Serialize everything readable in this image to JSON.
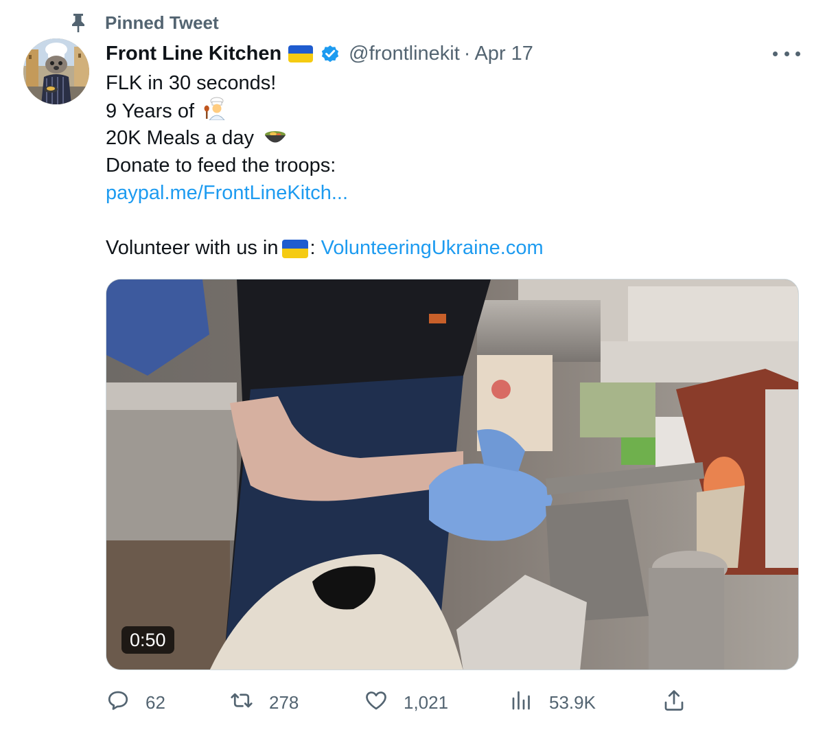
{
  "pinned": {
    "label": "Pinned Tweet",
    "icon": "pin-icon"
  },
  "author": {
    "display_name": "Front Line Kitchen",
    "handle": "@frontlinekit",
    "separator": "·",
    "date": "Apr 17",
    "verified": true
  },
  "body": {
    "line1": "FLK in 30 seconds!",
    "line2": "9 Years of",
    "line3": "20K Meals a day",
    "line4": "Donate to feed the troops:",
    "link1": "paypal.me/FrontLineKitch...",
    "line6_prefix": "Volunteer with us in",
    "line6_colon": ":",
    "link2": "VolunteeringUkraine.com"
  },
  "media": {
    "duration": "0:50"
  },
  "actions": {
    "replies": "62",
    "retweets": "278",
    "likes": "1,021",
    "views": "53.9K"
  },
  "colors": {
    "link": "#1d9bf0",
    "secondary_text": "#536471",
    "verified": "#1d9bf0",
    "flag_blue": "#1f5ccf",
    "flag_yellow": "#f5cb12"
  }
}
